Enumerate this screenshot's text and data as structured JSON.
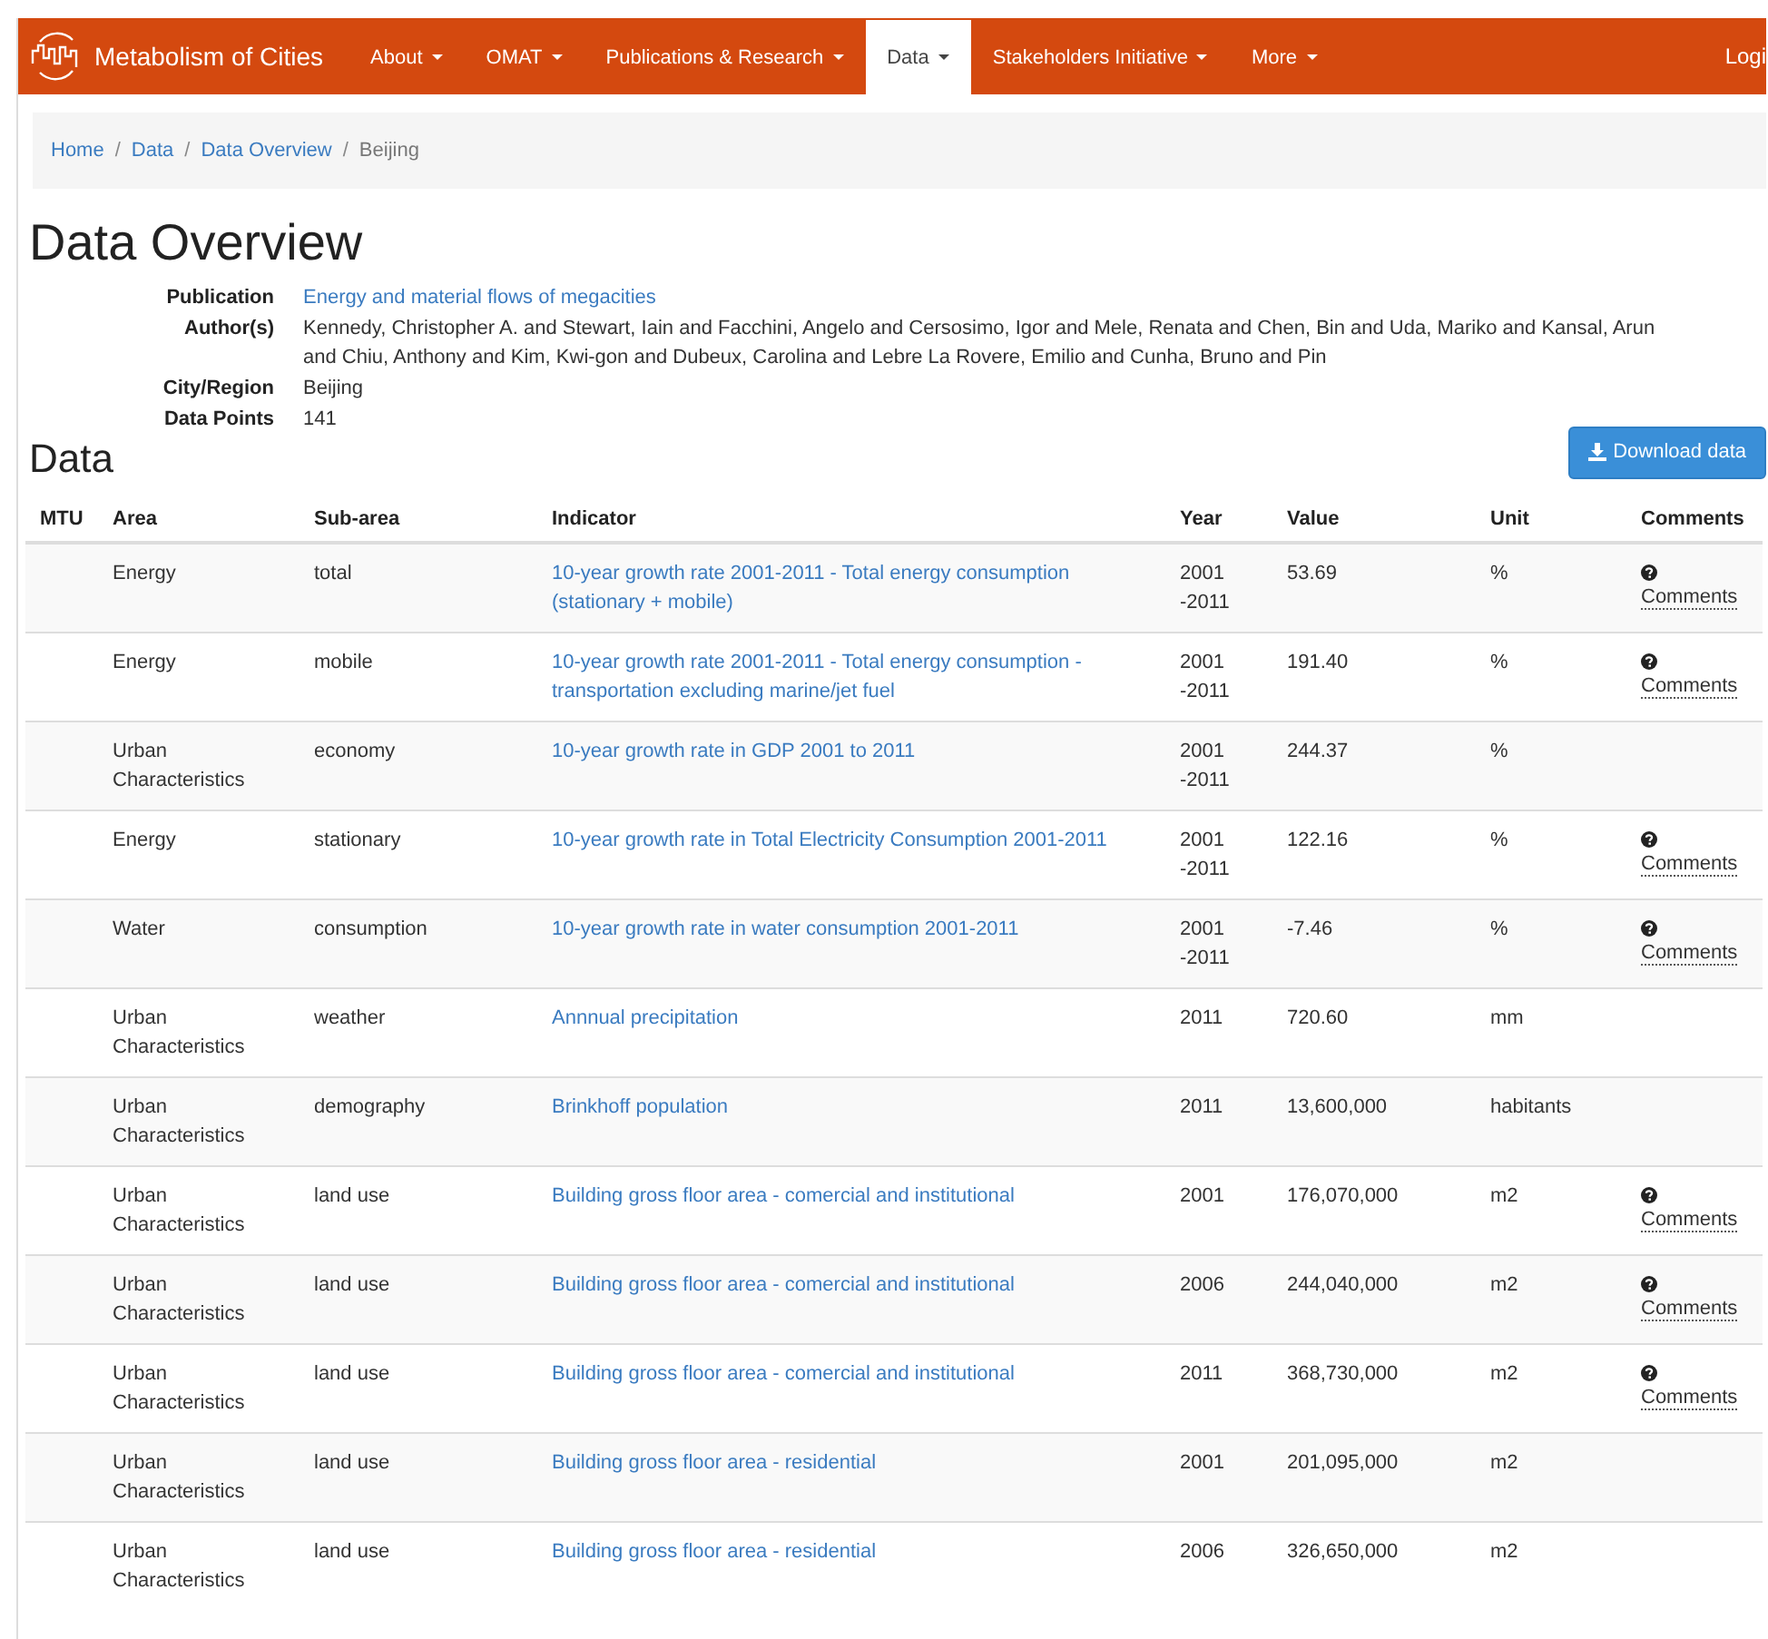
{
  "navbar": {
    "brand": "Metabolism of Cities",
    "items": [
      {
        "label": "About",
        "selected": false
      },
      {
        "label": "OMAT",
        "selected": false
      },
      {
        "label": "Publications & Research",
        "selected": false
      },
      {
        "label": "Data",
        "selected": true
      },
      {
        "label": "Stakeholders Initiative",
        "selected": false
      },
      {
        "label": "More",
        "selected": false
      }
    ],
    "login": "Logi"
  },
  "breadcrumb": [
    {
      "label": "Home",
      "kind": "link"
    },
    {
      "label": "/",
      "kind": "separator"
    },
    {
      "label": "Data",
      "kind": "link"
    },
    {
      "label": "/",
      "kind": "separator"
    },
    {
      "label": "Data Overview",
      "kind": "link"
    },
    {
      "label": "/",
      "kind": "separator"
    },
    {
      "label": "Beijing",
      "kind": "current"
    }
  ],
  "title": "Data Overview",
  "details": [
    {
      "label": "Publication",
      "kind": "link",
      "lines": [
        "Energy and material flows of megacities"
      ]
    },
    {
      "label": "Author(s)",
      "kind": "text",
      "lines": [
        "Kennedy, Christopher A. and Stewart, Iain and Facchini, Angelo and Cersosimo, Igor and Mele, Renata and Chen, Bin and Uda, Mariko and Kansal, Arun",
        "and Chiu, Anthony and Kim, Kwi-gon and Dubeux, Carolina and Lebre La Rovere, Emilio and Cunha, Bruno and Pin"
      ]
    },
    {
      "label": "City/Region",
      "kind": "text",
      "lines": [
        "Beijing"
      ]
    },
    {
      "label": "Data Points",
      "kind": "text",
      "lines": [
        "141"
      ]
    }
  ],
  "download_button": "Download data",
  "section_title": "Data",
  "table": {
    "columns": [
      "MTU",
      "Area",
      "Sub-area",
      "Indicator",
      "Year",
      "Value",
      "Unit",
      "Comments"
    ],
    "rows": [
      {
        "area": "Energy",
        "sub_area": "total",
        "indicator": "10-year growth rate 2001-2011 - Total energy consumption (stationary + mobile)",
        "year": "2001 -2011",
        "value": "53.69",
        "unit": "%",
        "comments": "Comments"
      },
      {
        "area": "Energy",
        "sub_area": "mobile",
        "indicator": "10-year growth rate 2001-2011 - Total energy consumption - transportation excluding marine/jet fuel",
        "year": "2001 -2011",
        "value": "191.40",
        "unit": "%",
        "comments": "Comments"
      },
      {
        "area": "Urban Characteristics",
        "sub_area": "economy",
        "indicator": "10-year growth rate in GDP 2001 to 2011",
        "year": "2001 -2011",
        "value": "244.37",
        "unit": "%"
      },
      {
        "area": "Energy",
        "sub_area": "stationary",
        "indicator": "10-year growth rate in Total Electricity Consumption 2001-2011",
        "year": "2001 -2011",
        "value": "122.16",
        "unit": "%",
        "comments": "Comments"
      },
      {
        "area": "Water",
        "sub_area": "consumption",
        "indicator": "10-year growth rate in water consumption 2001-2011",
        "year": "2001 -2011",
        "value": "-7.46",
        "unit": "%",
        "comments": "Comments"
      },
      {
        "area": "Urban Characteristics",
        "sub_area": "weather",
        "indicator": "Annnual precipitation",
        "year": "2011",
        "value": "720.60",
        "unit": "mm"
      },
      {
        "area": "Urban Characteristics",
        "sub_area": "demography",
        "indicator": "Brinkhoff population",
        "year": "2011",
        "value": "13,600,000",
        "unit": "habitants"
      },
      {
        "area": "Urban Characteristics",
        "sub_area": "land use",
        "indicator": "Building gross floor area - comercial and institutional",
        "year": "2001",
        "value": "176,070,000",
        "unit": "m2",
        "comments": "Comments"
      },
      {
        "area": "Urban Characteristics",
        "sub_area": "land use",
        "indicator": "Building gross floor area - comercial and institutional",
        "year": "2006",
        "value": "244,040,000",
        "unit": "m2",
        "comments": "Comments"
      },
      {
        "area": "Urban Characteristics",
        "sub_area": "land use",
        "indicator": "Building gross floor area - comercial and institutional",
        "year": "2011",
        "value": "368,730,000",
        "unit": "m2",
        "comments": "Comments"
      },
      {
        "area": "Urban Characteristics",
        "sub_area": "land use",
        "indicator": "Building gross floor area - residential",
        "year": "2001",
        "value": "201,095,000",
        "unit": "m2"
      },
      {
        "area": "Urban Characteristics",
        "sub_area": "land use",
        "indicator": "Building gross floor area - residential",
        "year": "2006",
        "value": "326,650,000",
        "unit": "m2"
      }
    ]
  }
}
